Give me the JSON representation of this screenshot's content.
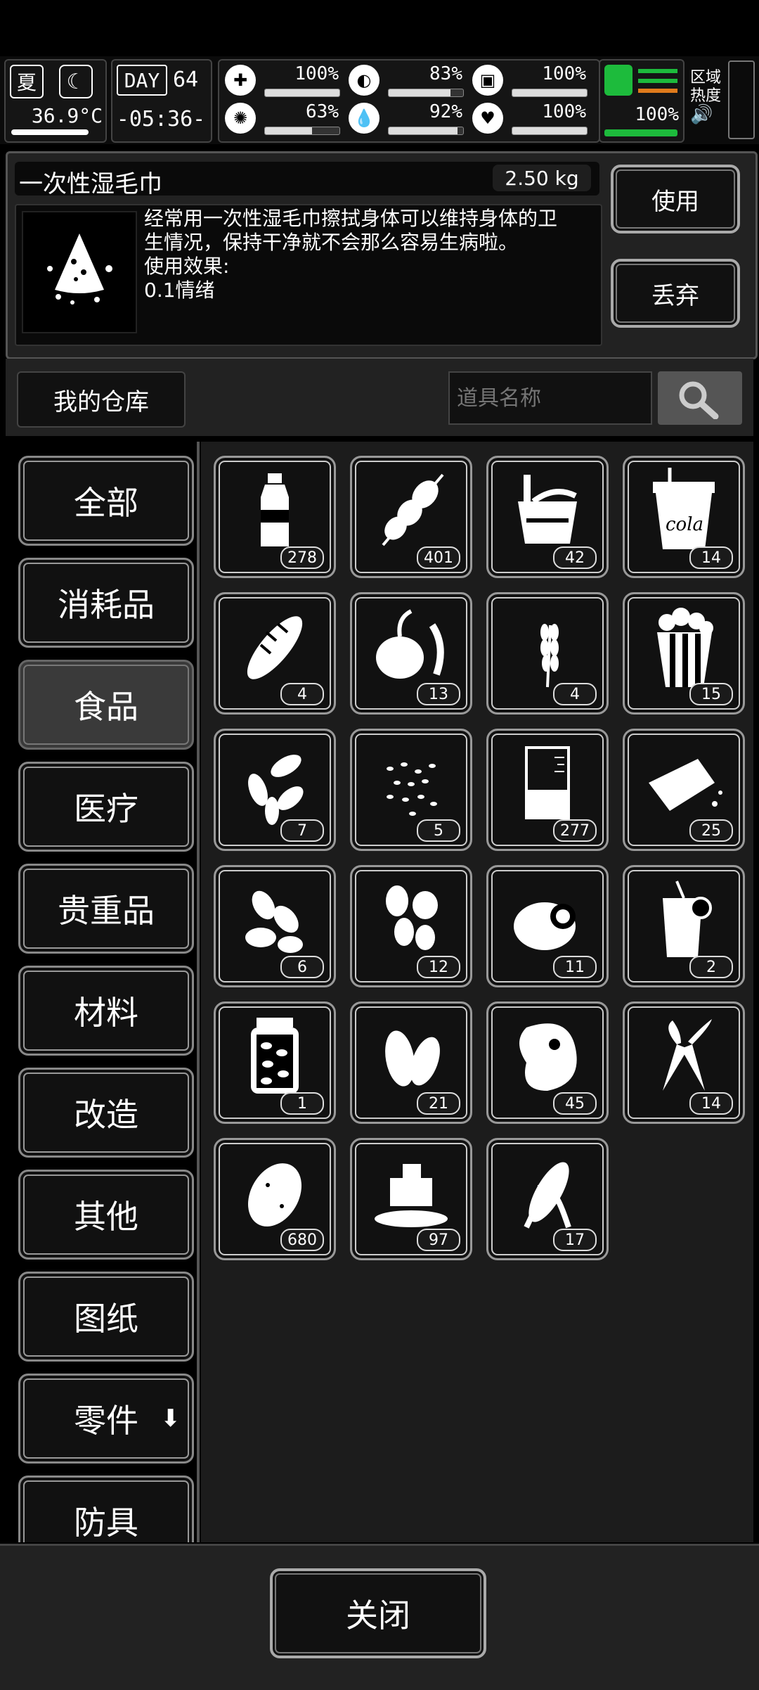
{
  "status": {
    "season": "夏",
    "temperature": "36.9°C",
    "day_label": "DAY",
    "day": "64",
    "time": "-05:36-",
    "stats": [
      {
        "icon": "medkit-icon",
        "value": "100%",
        "level": 1.0
      },
      {
        "icon": "stomach-icon",
        "value": "83%",
        "level": 0.83
      },
      {
        "icon": "pill-icon",
        "value": "100%",
        "level": 1.0
      },
      {
        "icon": "brain-icon",
        "value": "63%",
        "level": 0.63
      },
      {
        "icon": "water-drop-icon",
        "value": "92%",
        "level": 0.92
      },
      {
        "icon": "heart-icon",
        "value": "100%",
        "level": 1.0
      }
    ],
    "stamina": "100%",
    "region_heat_line1": "区域",
    "region_heat_line2": "热度"
  },
  "item": {
    "name": "一次性湿毛巾",
    "weight": "2.50 kg",
    "desc_line1": "经常用一次性湿毛巾擦拭身体可以维持身体的卫",
    "desc_line2": "生情况，保持干净就不会那么容易生病啦。",
    "desc_line3": "使用效果:",
    "desc_line4": "0.1情绪",
    "use_label": "使用",
    "drop_label": "丢弃"
  },
  "storage": {
    "title": "我的仓库",
    "search_placeholder": "道具名称"
  },
  "categories": [
    "全部",
    "消耗品",
    "食品",
    "医疗",
    "贵重品",
    "材料",
    "改造",
    "其他",
    "图纸",
    "零件",
    "防具"
  ],
  "active_category": "食品",
  "items": [
    {
      "icon": "water-bottle-icon",
      "count": "278"
    },
    {
      "icon": "skewer-icon",
      "count": "401"
    },
    {
      "icon": "instant-noodle-bucket-icon",
      "count": "42"
    },
    {
      "icon": "cola-cup-icon",
      "count": "14",
      "text": "cola"
    },
    {
      "icon": "bread-icon",
      "count": "4"
    },
    {
      "icon": "vegetable-icon",
      "count": "13"
    },
    {
      "icon": "wheat-icon",
      "count": "4"
    },
    {
      "icon": "popcorn-icon",
      "count": "15"
    },
    {
      "icon": "sunflower-seeds-icon",
      "count": "7"
    },
    {
      "icon": "seeds-icon",
      "count": "5"
    },
    {
      "icon": "beaker-icon",
      "count": "277"
    },
    {
      "icon": "tofu-icon",
      "count": "25"
    },
    {
      "icon": "almonds-icon",
      "count": "6"
    },
    {
      "icon": "beans-icon",
      "count": "12"
    },
    {
      "icon": "meat-icon",
      "count": "11"
    },
    {
      "icon": "juice-glass-icon",
      "count": "2"
    },
    {
      "icon": "pickle-jar-icon",
      "count": "1"
    },
    {
      "icon": "pistachio-icon",
      "count": "21"
    },
    {
      "icon": "steak-icon",
      "count": "45"
    },
    {
      "icon": "carrot-icon",
      "count": "14"
    },
    {
      "icon": "potato-icon",
      "count": "680"
    },
    {
      "icon": "butter-icon",
      "count": "97"
    },
    {
      "icon": "corn-icon",
      "count": "17"
    }
  ],
  "close_label": "关闭"
}
